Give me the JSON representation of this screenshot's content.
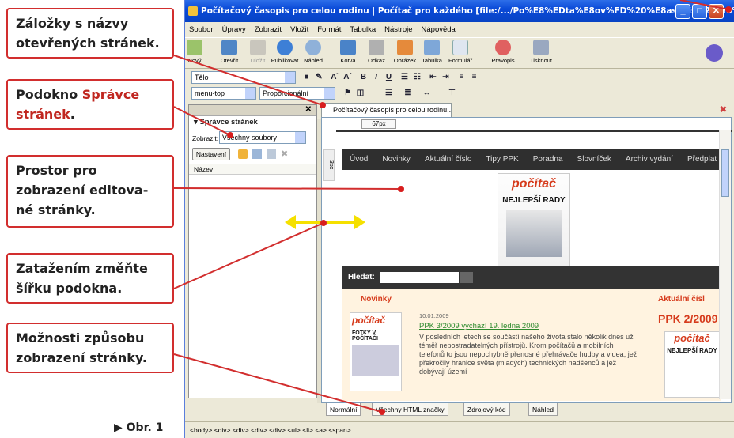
{
  "callouts": [
    {
      "text": "Záložky s názvy otevřených stránek."
    },
    {
      "text_plain": "Podokno ",
      "text_bold": "Správce stránek",
      "text_tail": "."
    },
    {
      "text": "Prostor pro zobrazení editova-né stránky."
    },
    {
      "text": "Zatažením změňte šířku podokna."
    },
    {
      "text": "Možnosti způsobu zobrazení stránky."
    }
  ],
  "figure_label": "▶ Obr. 1",
  "window": {
    "title": "Počítačový časopis pro celou rodinu | Počítač pro každého [file:/.../Po%E8%EDta%E8ov%FD%20%E8asopis%20pro%20ce..."
  },
  "menu": [
    "Soubor",
    "Úpravy",
    "Zobrazit",
    "Vložit",
    "Formát",
    "Tabulka",
    "Nástroje",
    "Nápověda"
  ],
  "toolbar": [
    "Nový",
    "Otevřít",
    "Uložit",
    "Publikovat",
    "Náhled",
    "Kotva",
    "Odkaz",
    "Obrázek",
    "Tabulka",
    "Formulář",
    "Pravopis",
    "Tisknout"
  ],
  "format": {
    "style": "Tělo",
    "class": "menu-top",
    "font": "Proporcionální"
  },
  "panel": {
    "title": "Správce stránek",
    "show_label": "Zobrazit:",
    "show_value": "Všechny soubory",
    "settings_button": "Nastavení",
    "column": "Název"
  },
  "doc_tab": "Počítačový časopis pro celou rodinu...",
  "ruler": "67px",
  "page": {
    "nav": [
      "Úvod",
      "Novinky",
      "Aktuální číslo",
      "Tipy PPK",
      "Poradna",
      "Slovníček",
      "Archiv vydání",
      "Předplat"
    ],
    "cover_brand": "počítač",
    "cover_headline": "NEJLEPŠÍ RADY",
    "search_label": "Hledat:",
    "left_heading": "Novinky",
    "right_heading": "Aktuální čísl",
    "date": "10.01.2009",
    "article_title": "PPK 3/2009 vychází 19. ledna 2009",
    "article_text": "V posledních letech se součástí našeho života stalo několik dnes už téměř nepostradatelných přístrojů. Krom počítačů a mobilních telefonů to jsou nepochybně přenosné přehrávače hudby a videa, jež překročily hranice světa (mladých) technických nadšenců a jež dobývají území",
    "issue": "PPK 2/2009",
    "thumb_text": "FOTKY V POČÍTAČI",
    "right_cover_headline": "NEJLEPŠÍ RADY"
  },
  "view_tabs": [
    "Normální",
    "Všechny HTML značky",
    "Zdrojový kód",
    "Náhled"
  ],
  "status": "<body> <div> <div> <div> <div> <ul> <li> <a> <span>",
  "colors": {
    "accent": "#d22e2e",
    "arrow": "#f5e000",
    "titlebar": "#0a4ad8",
    "page_nav": "#2f2f2f",
    "heading_red": "#d63b1c",
    "link_green": "#2e8a2e"
  }
}
